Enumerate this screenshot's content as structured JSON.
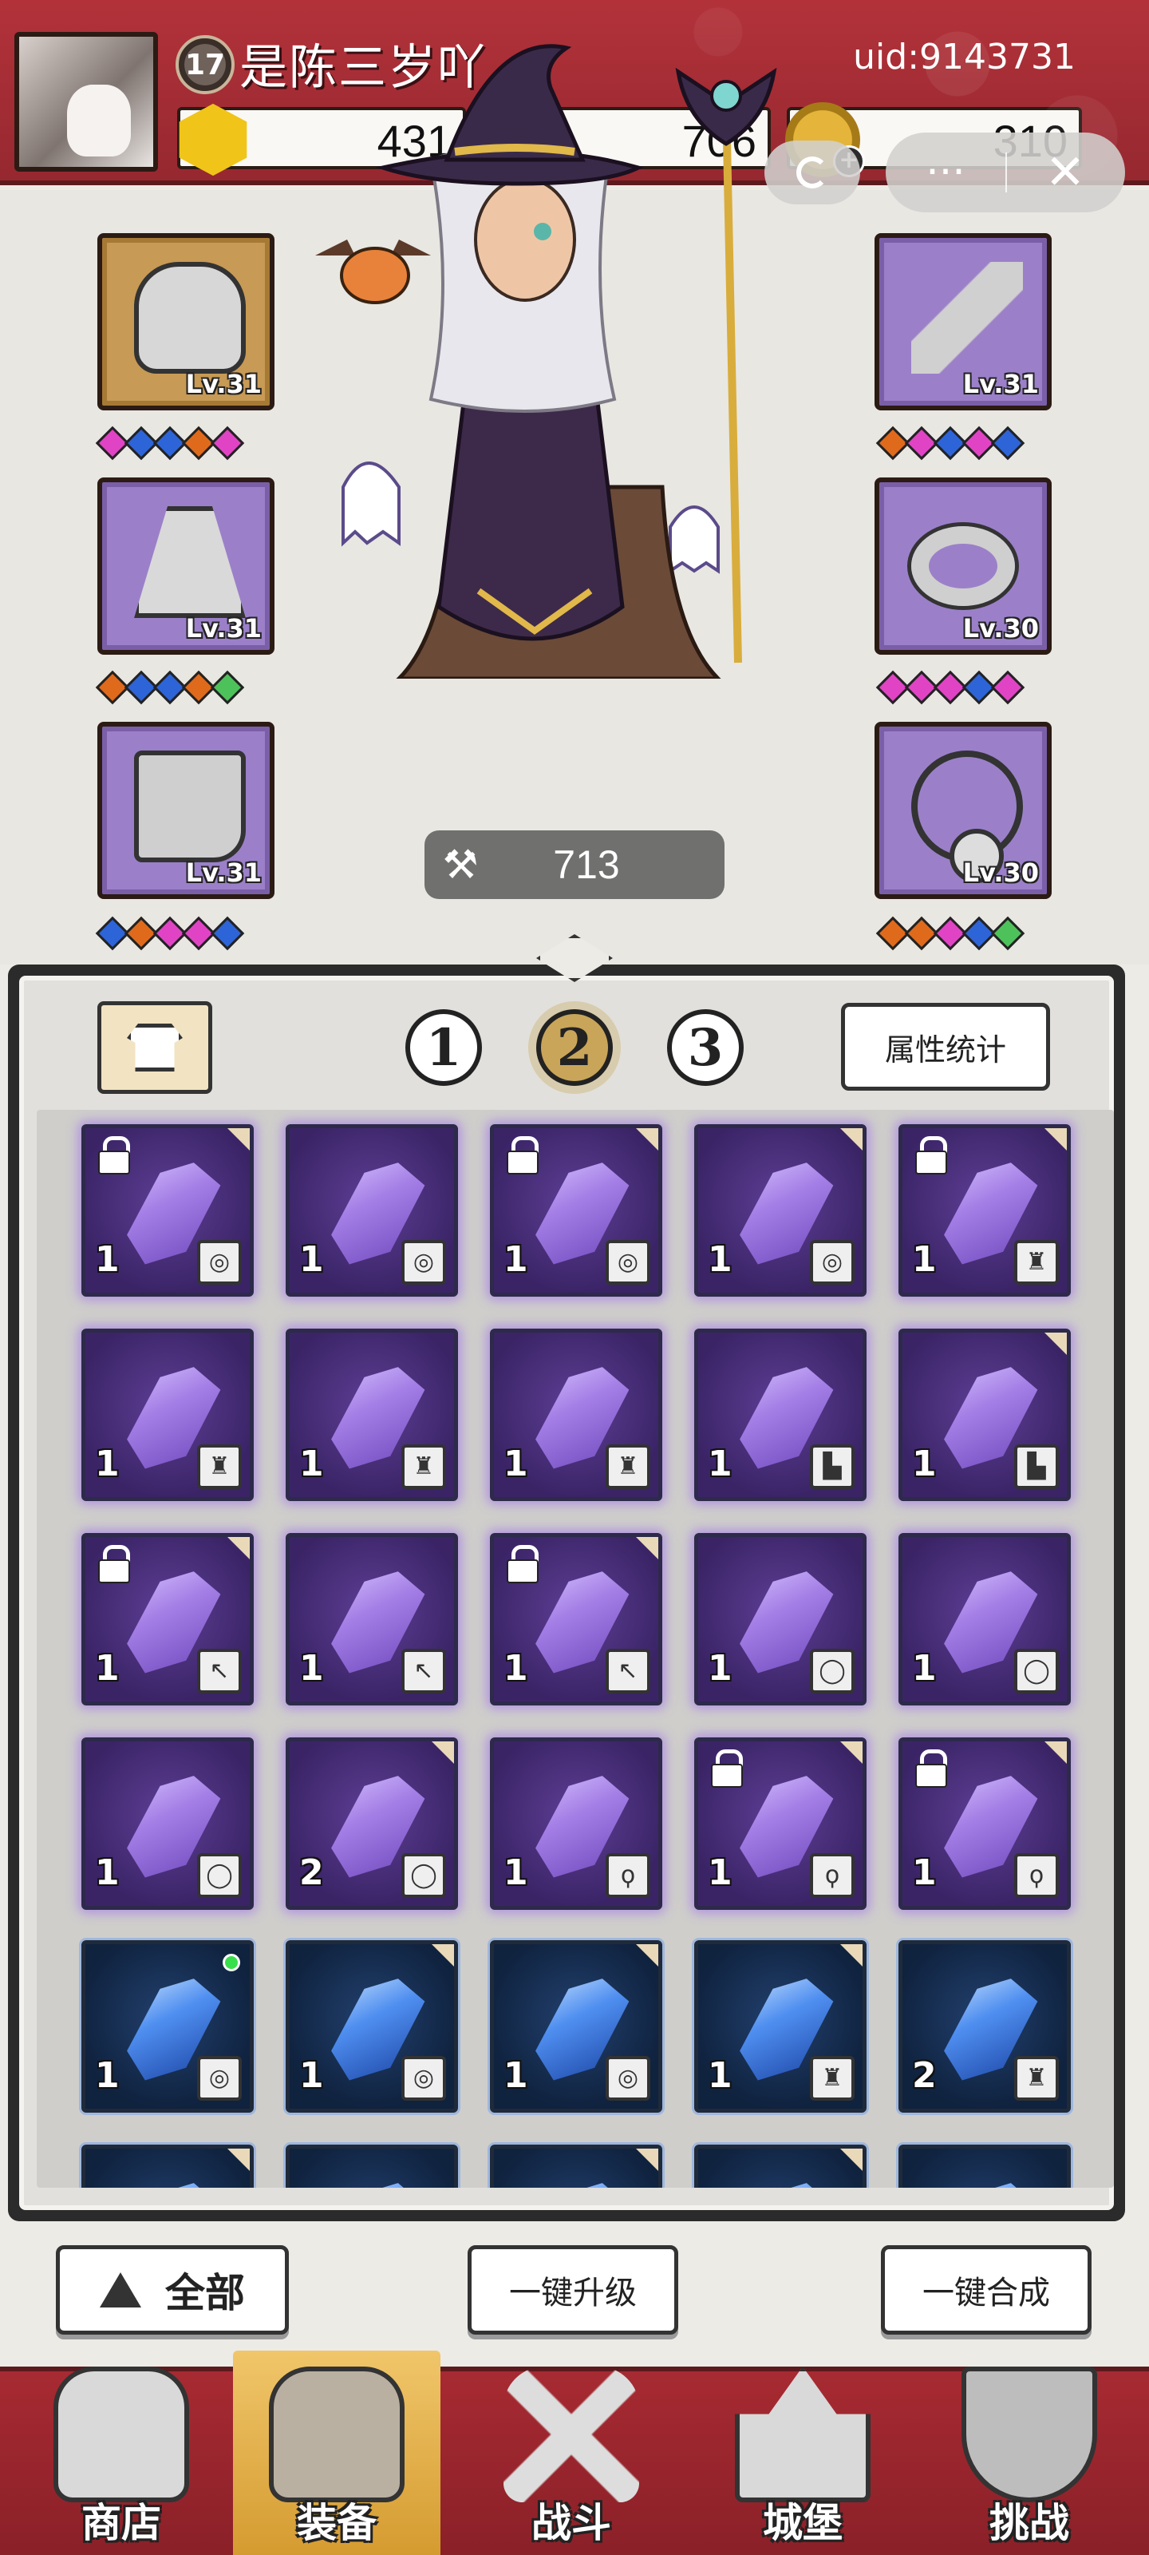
{
  "header": {
    "player_name": "是陈三岁吖",
    "level": "17",
    "uid": "uid:9143731",
    "resources": {
      "gold": "431",
      "gems": "706",
      "coins": "310"
    },
    "capsule": {
      "more": "···",
      "close": "✕"
    }
  },
  "character": {
    "power_icon": "hammer-icon",
    "power": "713",
    "left_slots": [
      {
        "item": "helmet",
        "level": "Lv.31",
        "rarity": "orange",
        "gems": [
          "pink",
          "blue",
          "blue",
          "orange",
          "pink"
        ]
      },
      {
        "item": "cape",
        "level": "Lv.31",
        "rarity": "purple",
        "gems": [
          "orange",
          "blue",
          "blue",
          "orange",
          "green"
        ]
      },
      {
        "item": "boots",
        "level": "Lv.31",
        "rarity": "purple",
        "gems": [
          "blue",
          "orange",
          "pink",
          "pink",
          "blue"
        ]
      }
    ],
    "right_slots": [
      {
        "item": "wand",
        "level": "Lv.31",
        "rarity": "purple",
        "gems": [
          "orange",
          "pink",
          "blue",
          "pink",
          "blue"
        ]
      },
      {
        "item": "ring",
        "level": "Lv.30",
        "rarity": "purple",
        "gems": [
          "pink",
          "pink",
          "pink",
          "blue",
          "pink"
        ]
      },
      {
        "item": "necklace",
        "level": "Lv.30",
        "rarity": "purple",
        "gems": [
          "orange",
          "orange",
          "pink",
          "blue",
          "green"
        ]
      }
    ]
  },
  "inventory": {
    "pages": [
      "1",
      "2",
      "3"
    ],
    "active_page": "2",
    "stats_button": "属性统计",
    "cells": [
      {
        "color": "purple",
        "qty": "1",
        "type": "helmet",
        "lock": true,
        "corner": true
      },
      {
        "color": "purple",
        "qty": "1",
        "type": "helmet",
        "lock": false,
        "corner": false
      },
      {
        "color": "purple",
        "qty": "1",
        "type": "helmet",
        "lock": true,
        "corner": true
      },
      {
        "color": "purple",
        "qty": "1",
        "type": "helmet",
        "lock": false,
        "corner": true
      },
      {
        "color": "purple",
        "qty": "1",
        "type": "cape",
        "lock": true,
        "corner": true
      },
      {
        "color": "purple",
        "qty": "1",
        "type": "cape",
        "lock": false,
        "corner": false
      },
      {
        "color": "purple",
        "qty": "1",
        "type": "cape",
        "lock": false,
        "corner": false
      },
      {
        "color": "purple",
        "qty": "1",
        "type": "cape",
        "lock": false,
        "corner": false
      },
      {
        "color": "purple",
        "qty": "1",
        "type": "boots",
        "lock": false,
        "corner": false
      },
      {
        "color": "purple",
        "qty": "1",
        "type": "boots",
        "lock": false,
        "corner": true
      },
      {
        "color": "purple",
        "qty": "1",
        "type": "wand",
        "lock": true,
        "corner": true
      },
      {
        "color": "purple",
        "qty": "1",
        "type": "wand",
        "lock": false,
        "corner": false
      },
      {
        "color": "purple",
        "qty": "1",
        "type": "wand",
        "lock": true,
        "corner": true
      },
      {
        "color": "purple",
        "qty": "1",
        "type": "ring",
        "lock": false,
        "corner": false
      },
      {
        "color": "purple",
        "qty": "1",
        "type": "ring",
        "lock": false,
        "corner": false
      },
      {
        "color": "purple",
        "qty": "1",
        "type": "ring",
        "lock": false,
        "corner": false
      },
      {
        "color": "purple",
        "qty": "2",
        "type": "ring",
        "lock": false,
        "corner": true
      },
      {
        "color": "purple",
        "qty": "1",
        "type": "necklace",
        "lock": false,
        "corner": false
      },
      {
        "color": "purple",
        "qty": "1",
        "type": "necklace",
        "lock": true,
        "corner": true
      },
      {
        "color": "purple",
        "qty": "1",
        "type": "necklace",
        "lock": true,
        "corner": true
      },
      {
        "color": "blue",
        "qty": "1",
        "type": "helmet",
        "lock": false,
        "corner": false,
        "new": true
      },
      {
        "color": "blue",
        "qty": "1",
        "type": "helmet",
        "lock": false,
        "corner": true
      },
      {
        "color": "blue",
        "qty": "1",
        "type": "helmet",
        "lock": false,
        "corner": true
      },
      {
        "color": "blue",
        "qty": "1",
        "type": "cape",
        "lock": false,
        "corner": true
      },
      {
        "color": "blue",
        "qty": "2",
        "type": "cape",
        "lock": false,
        "corner": false
      },
      {
        "color": "blue",
        "qty": "",
        "type": "",
        "lock": false,
        "corner": true
      },
      {
        "color": "blue",
        "qty": "",
        "type": "",
        "lock": false,
        "corner": false
      },
      {
        "color": "blue",
        "qty": "",
        "type": "",
        "lock": false,
        "corner": true
      },
      {
        "color": "blue",
        "qty": "",
        "type": "",
        "lock": false,
        "corner": true
      },
      {
        "color": "blue",
        "qty": "",
        "type": "",
        "lock": false,
        "corner": false
      }
    ]
  },
  "actions": {
    "filter": "全部",
    "upgrade_all": "一键升级",
    "merge_all": "一键合成"
  },
  "nav": [
    {
      "label": "商店",
      "icon": "shop-icon",
      "active": false
    },
    {
      "label": "装备",
      "icon": "backpack-icon",
      "active": true
    },
    {
      "label": "战斗",
      "icon": "swords-icon",
      "active": false
    },
    {
      "label": "城堡",
      "icon": "castle-icon",
      "active": false
    },
    {
      "label": "挑战",
      "icon": "shield-icon",
      "active": false
    }
  ],
  "colors": {
    "header_red": "#b3323a",
    "purple_slot": "#9b80c9",
    "orange_slot": "#c79a55",
    "nav_active": "#f0c66a"
  }
}
